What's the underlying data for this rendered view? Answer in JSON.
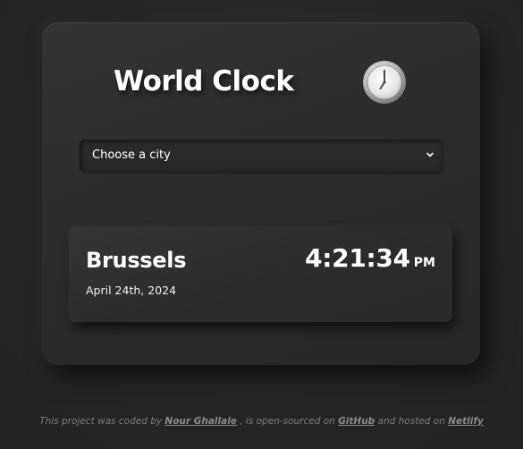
{
  "app": {
    "title": "World Clock",
    "clock_icon": "analog-clock-icon"
  },
  "city_select": {
    "selected": "Choose a city",
    "icon": "chevron-down-icon"
  },
  "city_card": {
    "city": "Brussels",
    "date": "April 24th, 2024",
    "time": "4:21:34",
    "ampm": "PM"
  },
  "footer": {
    "text_1": "This project was coded by",
    "author": "Nour Ghallale",
    "text_2": ", is open-sourced on",
    "github": "GitHub",
    "text_3": "and hosted on",
    "netlify": "Netlify"
  },
  "colors": {
    "background": "#262626",
    "card": "#2e2e2e",
    "text": "#ffffff",
    "footer_text": "#7d7d7d"
  }
}
